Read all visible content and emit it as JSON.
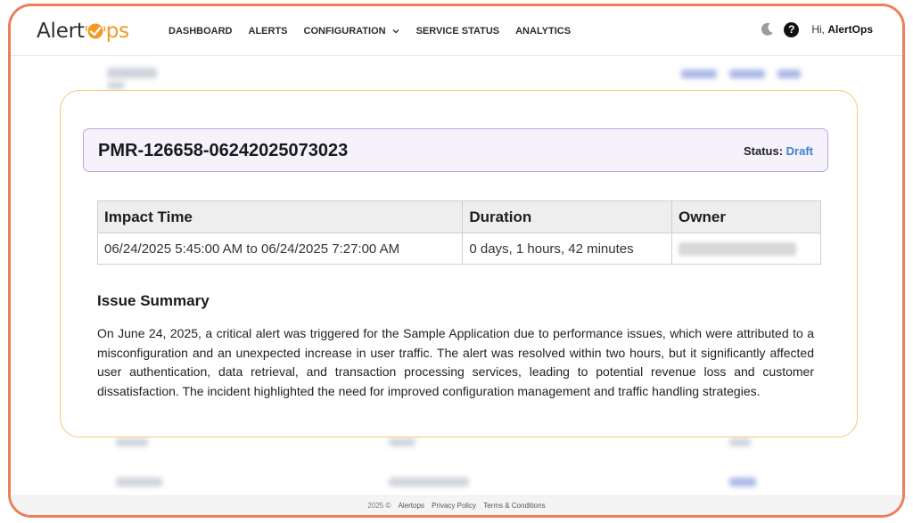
{
  "brand": {
    "name_left": "Alert",
    "name_right": "ps"
  },
  "nav": {
    "items": [
      "DASHBOARD",
      "ALERTS",
      "CONFIGURATION",
      "SERVICE STATUS",
      "ANALYTICS"
    ],
    "greeting_prefix": "Hi, ",
    "greeting_user": "AlertOps"
  },
  "icons": {
    "theme": "moon-icon",
    "help": "help-icon",
    "dropdown": "chevron-down-icon"
  },
  "colors": {
    "frame": "#ee7e5a",
    "card_border": "#f5c874",
    "title_border": "#b9a6de",
    "status_value": "#3f7fd0",
    "brand_orange": "#f29a23"
  },
  "report": {
    "id": "PMR-126658-06242025073023",
    "status_label": "Status:",
    "status_value": "Draft",
    "table": {
      "headers": [
        "Impact Time",
        "Duration",
        "Owner"
      ],
      "row": {
        "impact_time": "06/24/2025 5:45:00 AM to 06/24/2025 7:27:00 AM",
        "duration": "0 days, 1 hours, 42 minutes",
        "owner": ""
      }
    },
    "summary_heading": "Issue Summary",
    "summary_text": "On June 24, 2025, a critical alert was triggered for the Sample Application due to performance issues, which were attributed to a misconfiguration and an unexpected increase in user traffic. The alert was resolved within two hours, but it significantly affected user authentication, data retrieval, and transaction processing services, leading to potential revenue loss and customer dissatisfaction. The incident highlighted the need for improved configuration management and traffic handling strategies."
  },
  "footer": {
    "copyright": "2025 ©",
    "company": "Alertops",
    "privacy": "Privacy Policy",
    "terms": "Terms & Conditions"
  }
}
